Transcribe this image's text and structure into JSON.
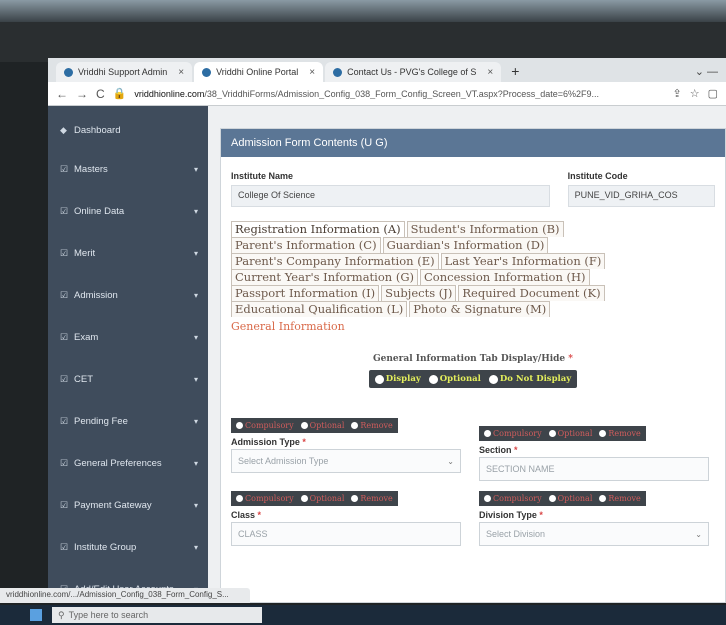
{
  "browser": {
    "tabs": [
      {
        "label": "Vriddhi Support Admin",
        "active": false
      },
      {
        "label": "Vriddhi Online Portal",
        "active": true
      },
      {
        "label": "Contact Us - PVG's College of S",
        "active": false
      }
    ],
    "new_tab": "+",
    "window_controls": "⌄   —",
    "nav_back": "←",
    "nav_forward": "→",
    "nav_reload": "C",
    "url_host": "vriddhionline.com",
    "url_path": "/38_VriddhiForms/Admission_Config_038_Form_Config_Screen_VT.aspx?Process_date=6%2F9..."
  },
  "sidebar": {
    "items": [
      {
        "label": "Dashboard",
        "icon": "dashboard-icon",
        "glyph": "◆",
        "chevron": ""
      },
      {
        "label": "Masters",
        "icon": "edit-icon",
        "glyph": "☑",
        "chevron": "▾"
      },
      {
        "label": "Online Data",
        "icon": "edit-icon",
        "glyph": "☑",
        "chevron": "▾"
      },
      {
        "label": "Merit",
        "icon": "edit-icon",
        "glyph": "☑",
        "chevron": "▾"
      },
      {
        "label": "Admission",
        "icon": "edit-icon",
        "glyph": "☑",
        "chevron": "▾"
      },
      {
        "label": "Exam",
        "icon": "edit-icon",
        "glyph": "☑",
        "chevron": "▾"
      },
      {
        "label": "CET",
        "icon": "edit-icon",
        "glyph": "☑",
        "chevron": "▾"
      },
      {
        "label": "Pending Fee",
        "icon": "edit-icon",
        "glyph": "☑",
        "chevron": "▾"
      },
      {
        "label": "General Preferences",
        "icon": "edit-icon",
        "glyph": "☑",
        "chevron": "▾"
      },
      {
        "label": "Payment Gateway",
        "icon": "edit-icon",
        "glyph": "☑",
        "chevron": "▾"
      },
      {
        "label": "Institute Group",
        "icon": "edit-icon",
        "glyph": "☑",
        "chevron": "▾"
      },
      {
        "label": "Add/Edit User Accounts",
        "icon": "edit-icon",
        "glyph": "☑",
        "chevron": "▾"
      }
    ]
  },
  "panel": {
    "title": "Admission Form Contents (U G)",
    "institute_name_label": "Institute Name",
    "institute_name": "College Of Science",
    "institute_code_label": "Institute Code",
    "institute_code": "PUNE_VID_GRIHA_COS"
  },
  "form_tabs": {
    "row1": [
      "Registration Information (A)",
      "Student's Information (B)"
    ],
    "row2": [
      "Parent's Information (C)",
      "Guardian's Information (D)"
    ],
    "row3": [
      "Parent's Company Information (E)",
      "Last Year's Information (F)"
    ],
    "row4": [
      "Current Year's Information (G)",
      "Concession Information (H)"
    ],
    "row5": [
      "Passport Information (I)",
      "Subjects (J)",
      "Required Document (K)"
    ],
    "row6": [
      "Educational Qualification (L)",
      "Photo & Signature (M)"
    ]
  },
  "general_info": {
    "section_title": "General Information",
    "tab_label": "General Information Tab Display/Hide",
    "required_mark": "*",
    "options": [
      "Display",
      "Optional",
      "Do Not Display"
    ]
  },
  "fields": {
    "option_labels": [
      "Compulsory",
      "Optional",
      "Remove"
    ],
    "admission_type": {
      "label": "Admission Type",
      "placeholder": "Select Admission Type"
    },
    "section": {
      "label": "Section",
      "placeholder": "SECTION NAME"
    },
    "class": {
      "label": "Class",
      "placeholder": "CLASS"
    },
    "division_type": {
      "label": "Division Type",
      "placeholder": "Select Division"
    }
  },
  "status_url": "vriddhionline.com/.../Admission_Config_038_Form_Config_S...",
  "taskbar": {
    "search_placeholder": "Type here to search"
  }
}
